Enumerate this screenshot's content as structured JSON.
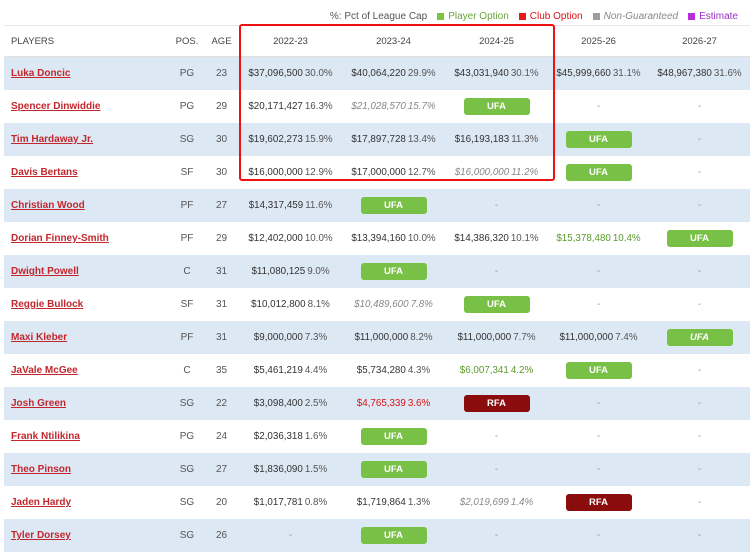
{
  "legend": {
    "pct_label": "%: Pct of League Cap",
    "player_option": "Player Option",
    "club_option": "Club Option",
    "non_guaranteed": "Non-Guaranteed",
    "estimate": "Estimate",
    "colors": {
      "player_option": "#7dc242",
      "club_option": "#e31b1b",
      "non_guaranteed": "#9e9e9e",
      "estimate": "#b72fd8"
    }
  },
  "table": {
    "headers": {
      "player": "PLAYERS",
      "pos": "POS.",
      "age": "AGE",
      "years": [
        "2022-23",
        "2023-24",
        "2024-25",
        "2025-26",
        "2026-27"
      ]
    },
    "rows": [
      {
        "name": "Luka Doncic",
        "pos": "PG",
        "age": "23",
        "cells": [
          {
            "t": "sal",
            "amount": "$37,096,500",
            "pct": "30.0%"
          },
          {
            "t": "sal",
            "amount": "$40,064,220",
            "pct": "29.9%"
          },
          {
            "t": "sal",
            "amount": "$43,031,940",
            "pct": "30.1%"
          },
          {
            "t": "sal",
            "amount": "$45,999,660",
            "pct": "31.1%"
          },
          {
            "t": "sal",
            "amount": "$48,967,380",
            "pct": "31.6%"
          }
        ]
      },
      {
        "name": "Spencer Dinwiddie",
        "pos": "PG",
        "age": "29",
        "cells": [
          {
            "t": "sal",
            "amount": "$20,171,427",
            "pct": "16.3%"
          },
          {
            "t": "sal",
            "style": "nong",
            "amount": "$21,028,570",
            "pct": "15.7%"
          },
          {
            "t": "badge",
            "kind": "ufa",
            "label": "UFA"
          },
          {
            "t": "dash",
            "label": "-"
          },
          {
            "t": "dash",
            "label": "-"
          }
        ]
      },
      {
        "name": "Tim Hardaway Jr.",
        "pos": "SG",
        "age": "30",
        "cells": [
          {
            "t": "sal",
            "amount": "$19,602,273",
            "pct": "15.9%"
          },
          {
            "t": "sal",
            "amount": "$17,897,728",
            "pct": "13.4%"
          },
          {
            "t": "sal",
            "amount": "$16,193,183",
            "pct": "11.3%"
          },
          {
            "t": "badge",
            "kind": "ufa",
            "label": "UFA"
          },
          {
            "t": "dash",
            "label": "-"
          }
        ]
      },
      {
        "name": "Davis Bertans",
        "pos": "SF",
        "age": "30",
        "cells": [
          {
            "t": "sal",
            "amount": "$16,000,000",
            "pct": "12.9%"
          },
          {
            "t": "sal",
            "amount": "$17,000,000",
            "pct": "12.7%"
          },
          {
            "t": "sal",
            "style": "nong",
            "amount": "$16,000,000",
            "pct": "11.2%"
          },
          {
            "t": "badge",
            "kind": "ufa",
            "label": "UFA"
          },
          {
            "t": "dash",
            "label": "-"
          }
        ]
      },
      {
        "name": "Christian Wood",
        "pos": "PF",
        "age": "27",
        "cells": [
          {
            "t": "sal",
            "amount": "$14,317,459",
            "pct": "11.6%"
          },
          {
            "t": "badge",
            "kind": "ufa",
            "label": "UFA"
          },
          {
            "t": "dash",
            "label": "-"
          },
          {
            "t": "dash",
            "label": "-"
          },
          {
            "t": "dash",
            "label": "-"
          }
        ]
      },
      {
        "name": "Dorian Finney-Smith",
        "pos": "PF",
        "age": "29",
        "cells": [
          {
            "t": "sal",
            "amount": "$12,402,000",
            "pct": "10.0%"
          },
          {
            "t": "sal",
            "amount": "$13,394,160",
            "pct": "10.0%"
          },
          {
            "t": "sal",
            "amount": "$14,386,320",
            "pct": "10.1%"
          },
          {
            "t": "sal",
            "style": "player",
            "amount": "$15,378,480",
            "pct": "10.4%"
          },
          {
            "t": "badge",
            "kind": "ufa",
            "label": "UFA"
          }
        ]
      },
      {
        "name": "Dwight Powell",
        "pos": "C",
        "age": "31",
        "cells": [
          {
            "t": "sal",
            "amount": "$11,080,125",
            "pct": "9.0%"
          },
          {
            "t": "badge",
            "kind": "ufa",
            "label": "UFA"
          },
          {
            "t": "dash",
            "label": "-"
          },
          {
            "t": "dash",
            "label": "-"
          },
          {
            "t": "dash",
            "label": "-"
          }
        ]
      },
      {
        "name": "Reggie Bullock",
        "pos": "SF",
        "age": "31",
        "cells": [
          {
            "t": "sal",
            "amount": "$10,012,800",
            "pct": "8.1%"
          },
          {
            "t": "sal",
            "style": "nong",
            "amount": "$10,489,600",
            "pct": "7.8%"
          },
          {
            "t": "badge",
            "kind": "ufa",
            "label": "UFA"
          },
          {
            "t": "dash",
            "label": "-"
          },
          {
            "t": "dash",
            "label": "-"
          }
        ]
      },
      {
        "name": "Maxi Kleber",
        "pos": "PF",
        "age": "31",
        "cells": [
          {
            "t": "sal",
            "amount": "$9,000,000",
            "pct": "7.3%"
          },
          {
            "t": "sal",
            "amount": "$11,000,000",
            "pct": "8.2%"
          },
          {
            "t": "sal",
            "amount": "$11,000,000",
            "pct": "7.7%"
          },
          {
            "t": "sal",
            "amount": "$11,000,000",
            "pct": "7.4%"
          },
          {
            "t": "badge",
            "kind": "ufa",
            "style": "nong",
            "label": "UFA"
          }
        ]
      },
      {
        "name": "JaVale McGee",
        "pos": "C",
        "age": "35",
        "cells": [
          {
            "t": "sal",
            "amount": "$5,461,219",
            "pct": "4.4%"
          },
          {
            "t": "sal",
            "amount": "$5,734,280",
            "pct": "4.3%"
          },
          {
            "t": "sal",
            "style": "player",
            "amount": "$6,007,341",
            "pct": "4.2%"
          },
          {
            "t": "badge",
            "kind": "ufa",
            "label": "UFA"
          },
          {
            "t": "dash",
            "label": "-"
          }
        ]
      },
      {
        "name": "Josh Green",
        "pos": "SG",
        "age": "22",
        "cells": [
          {
            "t": "sal",
            "amount": "$3,098,400",
            "pct": "2.5%"
          },
          {
            "t": "sal",
            "style": "club",
            "amount": "$4,765,339",
            "pct": "3.6%"
          },
          {
            "t": "badge",
            "kind": "rfa",
            "label": "RFA"
          },
          {
            "t": "dash",
            "label": "-"
          },
          {
            "t": "dash",
            "label": "-"
          }
        ]
      },
      {
        "name": "Frank Ntilikina",
        "pos": "PG",
        "age": "24",
        "cells": [
          {
            "t": "sal",
            "amount": "$2,036,318",
            "pct": "1.6%"
          },
          {
            "t": "badge",
            "kind": "ufa",
            "label": "UFA"
          },
          {
            "t": "dash",
            "label": "-"
          },
          {
            "t": "dash",
            "label": "-"
          },
          {
            "t": "dash",
            "label": "-"
          }
        ]
      },
      {
        "name": "Theo Pinson",
        "pos": "SG",
        "age": "27",
        "cells": [
          {
            "t": "sal",
            "amount": "$1,836,090",
            "pct": "1.5%"
          },
          {
            "t": "badge",
            "kind": "ufa",
            "label": "UFA"
          },
          {
            "t": "dash",
            "label": "-"
          },
          {
            "t": "dash",
            "label": "-"
          },
          {
            "t": "dash",
            "label": "-"
          }
        ]
      },
      {
        "name": "Jaden Hardy",
        "pos": "SG",
        "age": "20",
        "cells": [
          {
            "t": "sal",
            "amount": "$1,017,781",
            "pct": "0.8%"
          },
          {
            "t": "sal",
            "amount": "$1,719,864",
            "pct": "1.3%"
          },
          {
            "t": "sal",
            "style": "nong",
            "amount": "$2,019,699",
            "pct": "1.4%"
          },
          {
            "t": "badge",
            "kind": "rfa",
            "label": "RFA"
          },
          {
            "t": "dash",
            "label": "-"
          }
        ]
      },
      {
        "name": "Tyler Dorsey",
        "pos": "SG",
        "age": "26",
        "cells": [
          {
            "t": "dash",
            "label": "-"
          },
          {
            "t": "badge",
            "kind": "ufa",
            "label": "UFA"
          },
          {
            "t": "dash",
            "label": "-"
          },
          {
            "t": "dash",
            "label": "-"
          },
          {
            "t": "dash",
            "label": "-"
          }
        ]
      }
    ]
  }
}
